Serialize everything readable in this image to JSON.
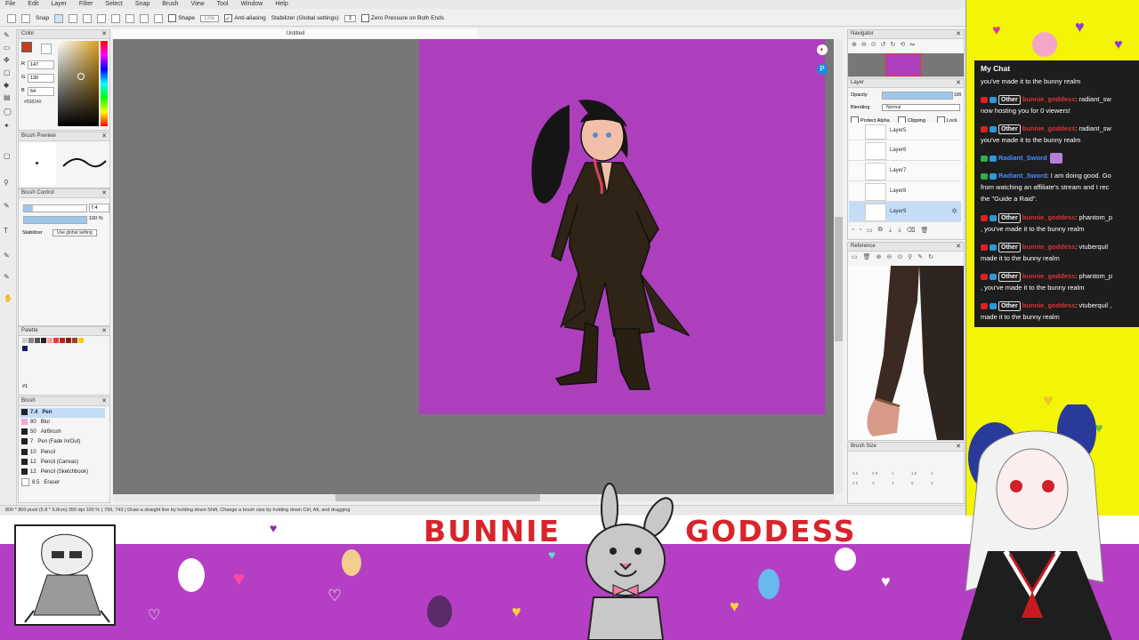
{
  "app": {
    "menu": [
      "File",
      "Edit",
      "Layer",
      "Filter",
      "Select",
      "Snap",
      "Brush",
      "View",
      "Tool",
      "Window",
      "Help"
    ],
    "toolbar": {
      "snap_label": "Snap",
      "shape_label": "Shape",
      "shape_value": "Line",
      "antialias_label": "Anti-aliasing",
      "stabilizer_label": "Stabilizer (Global settings)",
      "stabilizer_value": "3",
      "zero_pressure_label": "Zero Pressure on Both Ends"
    },
    "doc_tab": "Untitled",
    "color_panel": {
      "title": "Color",
      "r_label": "R",
      "r_value": "147",
      "g_label": "G",
      "g_value": "130",
      "b_label": "B",
      "b_value": "64",
      "hex": "#938240"
    },
    "brush_preview": {
      "title": "Brush Preview"
    },
    "brush_control": {
      "title": "Brush Control",
      "size_value": "7.4",
      "opacity_value": "100 %",
      "stabilizer_label": "Stabilizer",
      "stabilizer_value": "Use global setting"
    },
    "palette": {
      "title": "Palette",
      "page": "#1"
    },
    "brush_list": {
      "title": "Brush",
      "items": [
        {
          "size": "7.4",
          "name": "Pen",
          "color": "#222222"
        },
        {
          "size": "80",
          "name": "Blur",
          "color": "#f5a6d8"
        },
        {
          "size": "50",
          "name": "AirBrush",
          "color": "#222222"
        },
        {
          "size": "7",
          "name": "Pen (Fade In/Out)",
          "color": "#222222"
        },
        {
          "size": "10",
          "name": "Pencil",
          "color": "#222222"
        },
        {
          "size": "12",
          "name": "Pencil (Canvas)",
          "color": "#222222"
        },
        {
          "size": "12",
          "name": "Pencil (Sketchbook)",
          "color": "#222222"
        },
        {
          "size": "8.5",
          "name": "Eraser",
          "color": "#ffffff"
        }
      ]
    },
    "navigator": {
      "title": "Navigator"
    },
    "layer_panel": {
      "title": "Layer",
      "opacity_label": "Opacity",
      "opacity_value": "100",
      "blending_label": "Blending",
      "blending_value": "Normal",
      "protect_alpha": "Protect Alpha",
      "clipping": "Clipping",
      "lock": "Lock",
      "layers": [
        "Layer5",
        "Layer6",
        "Layer7",
        "Layer8",
        "Layer9"
      ]
    },
    "reference": {
      "title": "Reference"
    },
    "brush_size": {
      "title": "Brush Size",
      "sizes": [
        "0.6",
        "0.8",
        "1",
        "1.5",
        "2",
        "2.5",
        "3",
        "4",
        "5",
        "6"
      ]
    },
    "status": "800 * 800 pixel   (5.8 * 5.8cm)   350 dpi   100 %   ( 799, 743 )   Draw a straight line by holding down Shift, Change a brush size by holding down Ctrl, Alt, and dragging"
  },
  "chat": {
    "title": "My Chat",
    "messages": [
      {
        "user": "",
        "badge": "",
        "text": "you've made it to the bunny realm"
      },
      {
        "user": "bunnie_goddess",
        "badge": "Other",
        "text": ": radiant_sw",
        "cont": "now hosting you for 0 viewers!"
      },
      {
        "user": "bunnie_goddess",
        "badge": "Other",
        "text": ": radiant_sw",
        "cont": "you've made it to the bunny realm"
      },
      {
        "user": "Radiant_Sword",
        "badge": "",
        "text": ""
      },
      {
        "user": "Radiant_Sword",
        "badge": "",
        "text": ": I am doing good. Go",
        "cont": "from watching an affiliate's stream and I rec",
        "cont2": "the \"Guide a Raid\"."
      },
      {
        "user": "bunnie_goddess",
        "badge": "Other",
        "text": ": phantom_p",
        "cont": ", you've made it to the bunny realm"
      },
      {
        "user": "bunnie_goddess",
        "badge": "Other",
        "text": ": vtuberquil",
        "cont": "made it to the bunny realm"
      },
      {
        "user": "bunnie_goddess",
        "badge": "Other",
        "text": ": phantom_p",
        "cont": ", you've made it to the bunny realm"
      },
      {
        "user": "bunnie_goddess",
        "badge": "Other",
        "text": ": vtuberquil ,",
        "cont": "made it to the bunny realm"
      }
    ]
  },
  "overlay": {
    "title_left": "BUNNIE",
    "title_right": "GODDESS"
  },
  "colors": {
    "stream_yellow": "#f4f406",
    "artboard_purple": "#ad3fbc",
    "banner_purple": "#b53fc4",
    "title_red": "#d8242b",
    "chat_bg": "#1d1d1d"
  }
}
